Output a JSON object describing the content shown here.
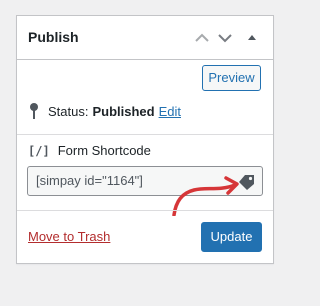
{
  "panel": {
    "title": "Publish",
    "header_icons": [
      "chevron-up-icon",
      "chevron-down-icon",
      "triangle-up-icon"
    ]
  },
  "actions": {
    "preview_label": "Preview"
  },
  "status": {
    "icon": "pin-icon",
    "label": "Status:",
    "value": "Published",
    "edit_label": "Edit"
  },
  "shortcode": {
    "icon_text": "[/]",
    "label": "Form Shortcode",
    "value": "[simpay id=\"1164\"]",
    "copy_icon": "tag-icon"
  },
  "annotation": {
    "arrow_color": "#d63638"
  },
  "footer": {
    "trash_label": "Move to Trash",
    "update_label": "Update"
  },
  "colors": {
    "accent": "#2271b1",
    "danger": "#b32d2e",
    "border": "#c3c4c7"
  }
}
